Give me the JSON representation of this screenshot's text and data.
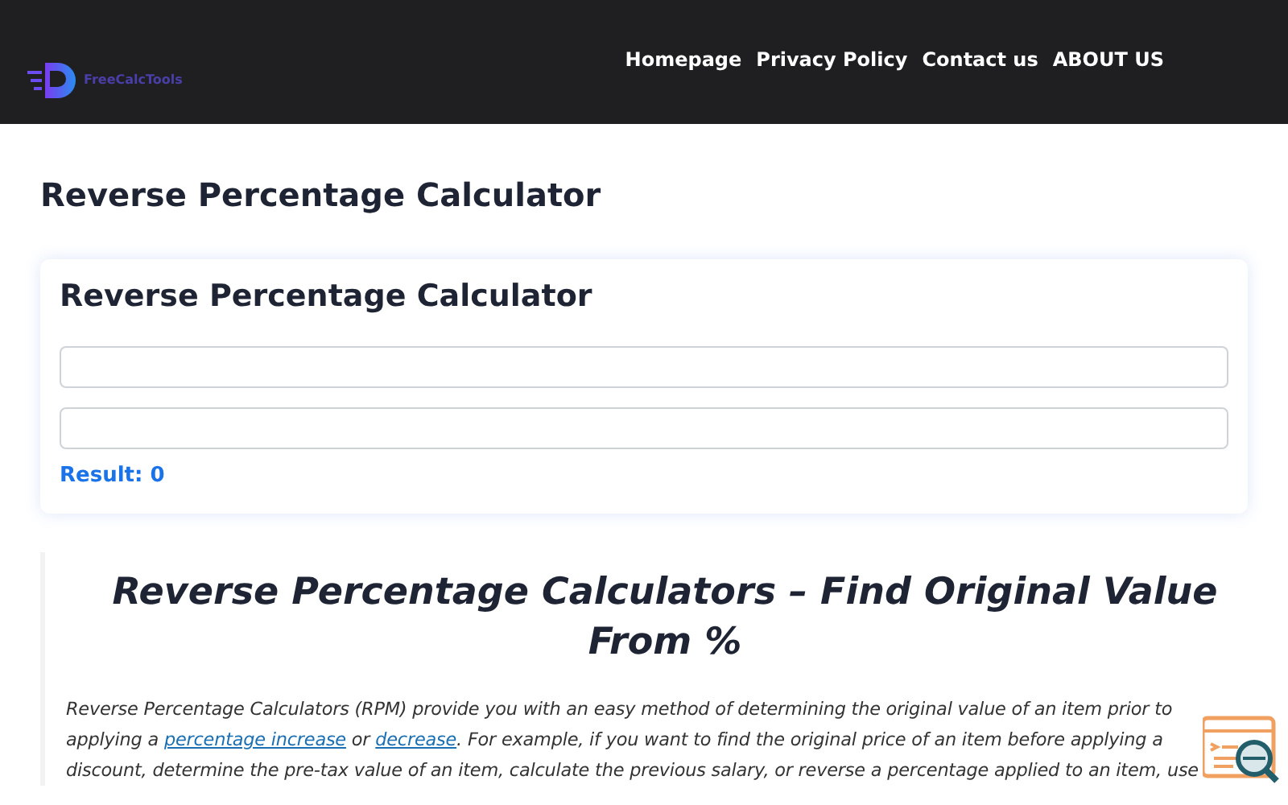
{
  "header": {
    "logo_text": "FreeCalcTools",
    "nav": [
      "Homepage",
      "Privacy Policy",
      "Contact us",
      "ABOUT US"
    ]
  },
  "page_title": "Reverse Percentage Calculator",
  "calculator": {
    "title": "Reverse Percentage Calculator",
    "fields": [
      {
        "kind": "text"
      },
      {
        "kind": "text"
      }
    ],
    "result": "Result: 0"
  },
  "article": {
    "heading": "Reverse Percentage Calculators – Find Original Value From %",
    "paragraph": [
      {
        "kind": "text",
        "text": "Reverse Percentage Calculators (RPM) provide you with an easy method of determining the original value of an item prior to applying a "
      },
      {
        "kind": "link",
        "text": "percentage increase"
      },
      {
        "kind": "text",
        "text": " or "
      },
      {
        "kind": "link",
        "text": "decrease"
      },
      {
        "kind": "text",
        "text": ". For example, if you want to find the original price of an item before applying a discount, determine the pre-tax value of an item, calculate the previous salary, or reverse a percentage applied to an item, use"
      }
    ]
  }
}
